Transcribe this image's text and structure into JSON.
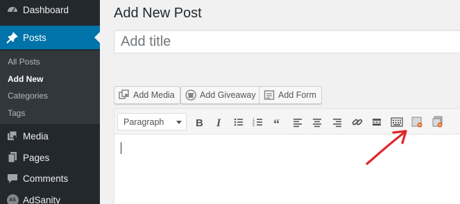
{
  "sidebar": {
    "dashboard": {
      "label": "Dashboard",
      "icon": "dashboard-icon"
    },
    "posts": {
      "label": "Posts",
      "icon": "pushpin-icon"
    },
    "submenu": [
      {
        "label": "All Posts",
        "current": false
      },
      {
        "label": "Add New",
        "current": true
      },
      {
        "label": "Categories",
        "current": false
      },
      {
        "label": "Tags",
        "current": false
      }
    ],
    "media": {
      "label": "Media",
      "icon": "media-icon"
    },
    "pages": {
      "label": "Pages",
      "icon": "pages-icon"
    },
    "comments": {
      "label": "Comments",
      "icon": "comments-icon"
    },
    "adsanity": {
      "label": "AdSanity",
      "badge": "AS"
    }
  },
  "main": {
    "title": "Add New Post",
    "title_placeholder": "Add title",
    "buttons": {
      "add_media": "Add Media",
      "add_giveaway": "Add Giveaway",
      "add_form": "Add Form"
    },
    "editor": {
      "format": "Paragraph",
      "toolbar_icons": [
        "bold-icon",
        "italic-icon",
        "bulleted-list-icon",
        "numbered-list-icon",
        "blockquote-icon",
        "align-left-icon",
        "align-center-icon",
        "align-right-icon",
        "link-icon",
        "read-more-icon",
        "toolbar-toggle-icon",
        "insert-form-icon",
        "insert-giveaway-icon"
      ]
    }
  },
  "colors": {
    "sidebar_bg": "#23282d",
    "submenu_bg": "#32373c",
    "accent": "#0073aa",
    "annotation": "#e0242b"
  }
}
